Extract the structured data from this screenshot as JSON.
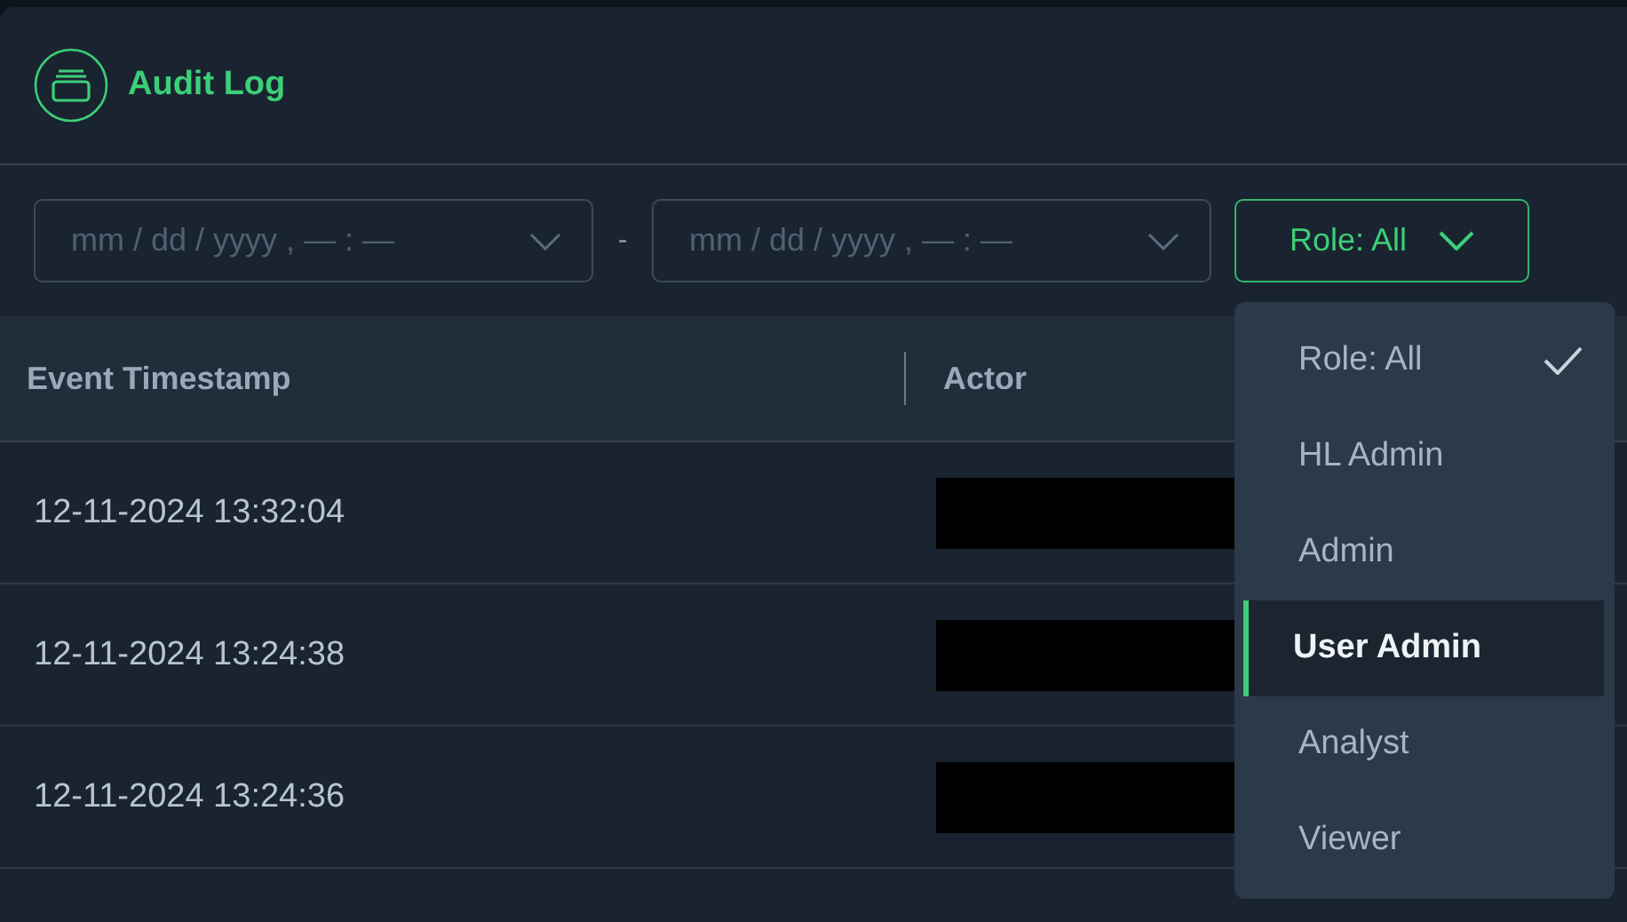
{
  "header": {
    "title": "Audit Log"
  },
  "filters": {
    "start": {
      "placeholder": "mm / dd / yyyy , — : —"
    },
    "separator": "-",
    "end": {
      "placeholder": "mm / dd / yyyy , — : —"
    },
    "role_button": {
      "label": "Role: All"
    }
  },
  "role_menu": [
    {
      "label": "Role: All",
      "selected": true,
      "highlighted": false
    },
    {
      "label": "HL Admin",
      "selected": false,
      "highlighted": false
    },
    {
      "label": "Admin",
      "selected": false,
      "highlighted": false
    },
    {
      "label": "User Admin",
      "selected": false,
      "highlighted": true
    },
    {
      "label": "Analyst",
      "selected": false,
      "highlighted": false
    },
    {
      "label": "Viewer",
      "selected": false,
      "highlighted": false
    }
  ],
  "table": {
    "columns": [
      "Event Timestamp",
      "Actor"
    ],
    "rows": [
      {
        "timestamp": "12-11-2024 13:32:04",
        "actor_redacted": true
      },
      {
        "timestamp": "12-11-2024 13:24:38",
        "actor_redacted": true
      },
      {
        "timestamp": "12-11-2024 13:24:36",
        "actor_redacted": true
      }
    ]
  }
}
